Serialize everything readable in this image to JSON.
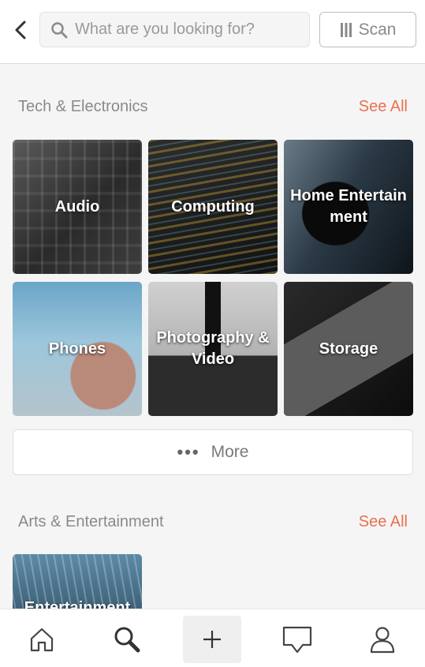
{
  "header": {
    "search_placeholder": "What are you looking for?",
    "scan_label": "Scan"
  },
  "sections": [
    {
      "title": "Tech & Electronics",
      "see_all": "See All",
      "categories": [
        {
          "label": "Audio"
        },
        {
          "label": "Computing"
        },
        {
          "label": "Home Entertainment"
        },
        {
          "label": "Phones"
        },
        {
          "label": "Photography & Video"
        },
        {
          "label": "Storage"
        }
      ],
      "more_label": "More"
    },
    {
      "title": "Arts & Entertainment",
      "see_all": "See All",
      "categories": [
        {
          "label": "Entertainment"
        }
      ]
    }
  ],
  "tabs": [
    "home-icon",
    "search-icon",
    "plus-icon",
    "chat-icon",
    "profile-icon"
  ],
  "colors": {
    "accent": "#e8714f",
    "background": "#f5f5f5"
  }
}
